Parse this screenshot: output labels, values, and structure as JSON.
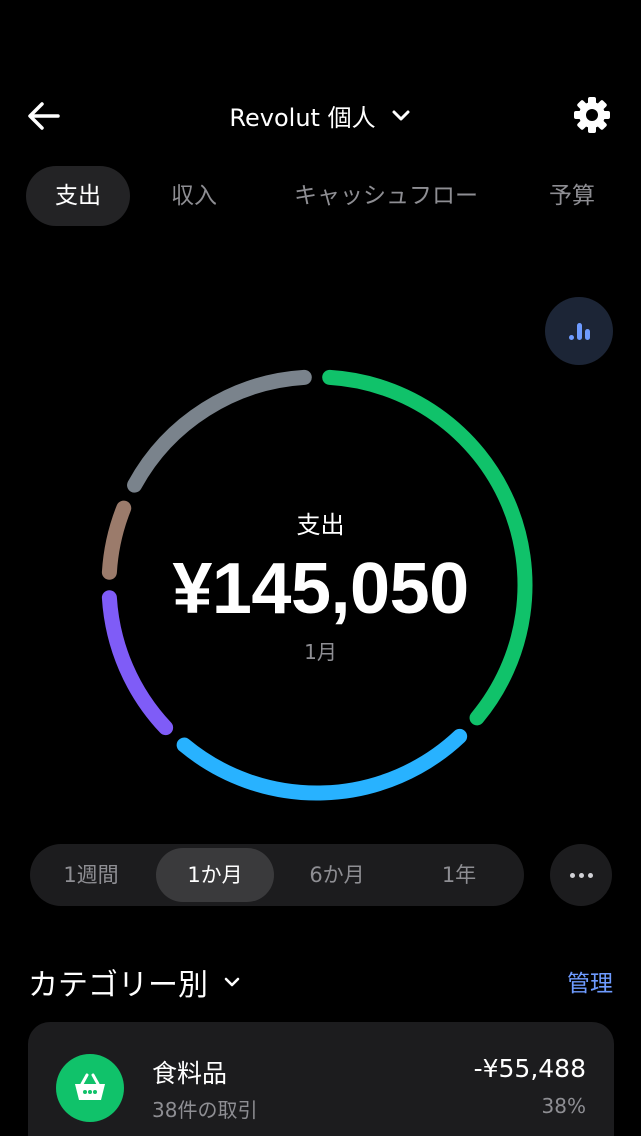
{
  "header": {
    "title": "Revolut 個人"
  },
  "tabs": [
    {
      "label": "支出",
      "active": true
    },
    {
      "label": "収入",
      "active": false
    },
    {
      "label": "キャッシュフロー",
      "active": false
    },
    {
      "label": "予算",
      "active": false
    }
  ],
  "summary": {
    "label": "支出",
    "amount": "¥145,050",
    "period": "1月"
  },
  "donut_segments": [
    {
      "color": "#10c26a",
      "share": 0.37
    },
    {
      "color": "#28b2ff",
      "share": 0.25
    },
    {
      "color": "#7f5cf7",
      "share": 0.13
    },
    {
      "color": "#9b7b6b",
      "share": 0.07
    },
    {
      "color": "#7a838c",
      "share": 0.18
    }
  ],
  "periods": [
    {
      "label": "1週間",
      "active": false
    },
    {
      "label": "1か月",
      "active": true
    },
    {
      "label": "6か月",
      "active": false
    },
    {
      "label": "1年",
      "active": false
    }
  ],
  "categories_section": {
    "title": "カテゴリー別",
    "manage_label": "管理"
  },
  "categories": [
    {
      "name": "食料品",
      "count": "38件の取引",
      "amount": "-¥55,488",
      "percent": "38%",
      "icon": "basket-icon",
      "color": "#10c26a"
    }
  ]
}
